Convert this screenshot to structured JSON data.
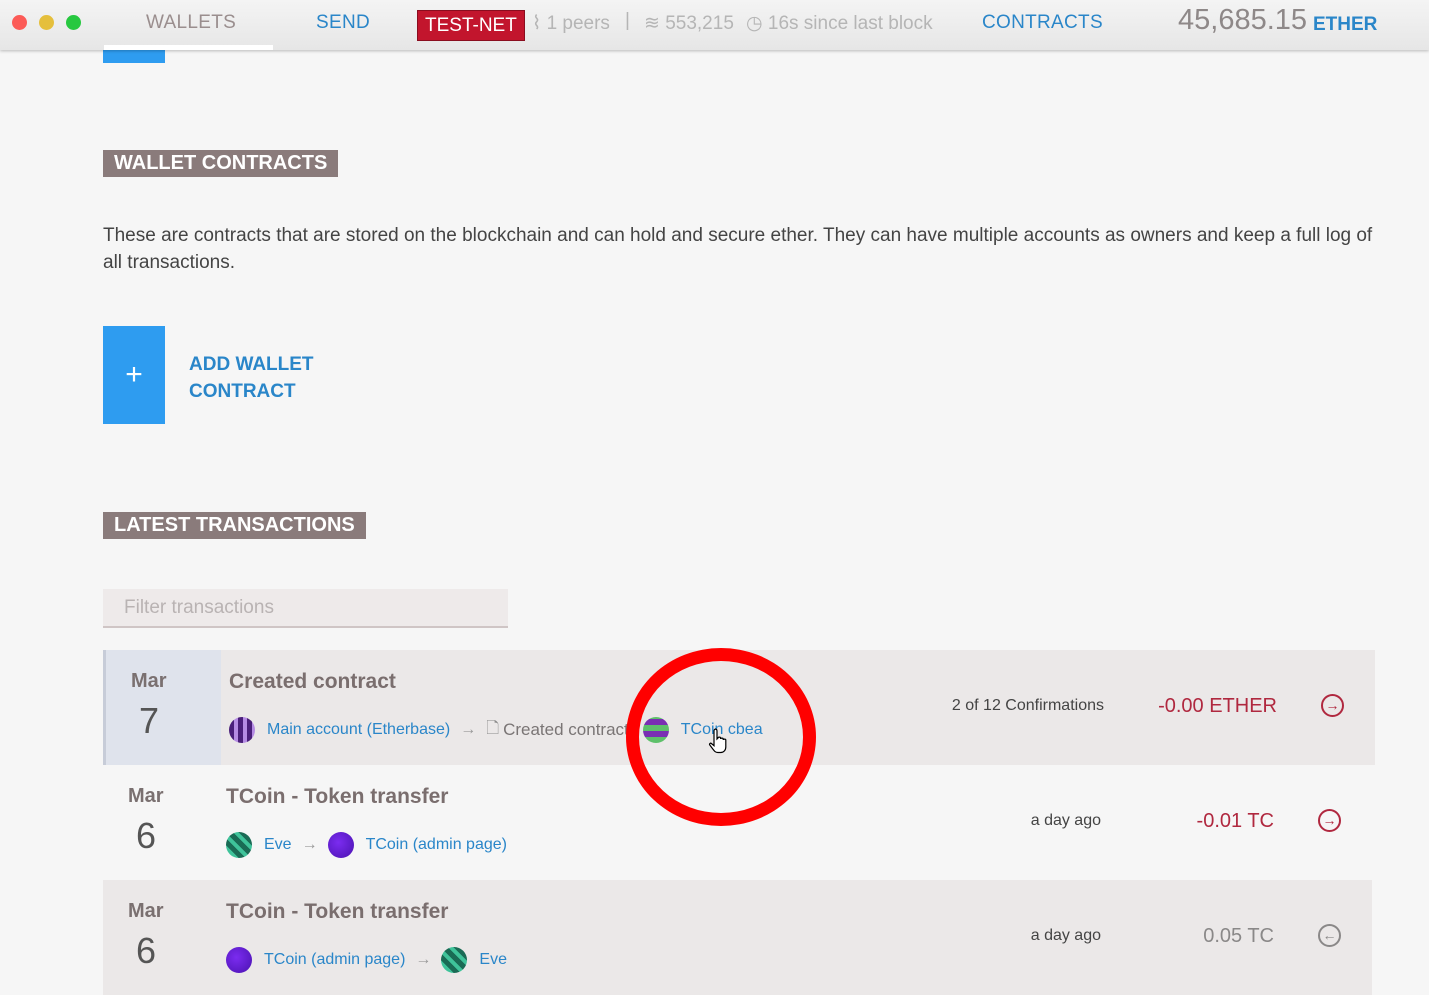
{
  "window": {
    "traffic_lights": [
      "#fc5b57",
      "#e5bf3c",
      "#27c840"
    ]
  },
  "nav": {
    "wallets": "WALLETS",
    "send": "SEND",
    "network_badge": "TEST-NET",
    "peers": "1 peers",
    "separator": "|",
    "block_number": "553,215",
    "since_last_block": "16s since last block",
    "contracts": "CONTRACTS",
    "balance": "45,685.15",
    "balance_unit": "ETHER"
  },
  "wallet_contracts": {
    "heading": "WALLET CONTRACTS",
    "description": "These are contracts that are stored on the blockchain and can hold and secure ether. They can have multiple accounts as owners and keep a full log of all transactions.",
    "add_button_icon": "+",
    "add_label": "ADD WALLET CONTRACT"
  },
  "latest_transactions": {
    "heading": "LATEST TRANSACTIONS",
    "filter_placeholder": "Filter transactions",
    "rows": [
      {
        "month": "Mar",
        "day": "7",
        "title": "Created contract",
        "from": "Main account (Etherbase)",
        "arrow": "→",
        "created_label": "Created contract",
        "to": "TCoin cbea",
        "status": "2 of 12 Confirmations",
        "amount": "-0.00 ETHER",
        "direction_icon": "arrow-right-circle-icon"
      },
      {
        "month": "Mar",
        "day": "6",
        "title": "TCoin - Token transfer",
        "from": "Eve",
        "arrow": "→",
        "to": "TCoin (admin page)",
        "status": "a day ago",
        "amount": "-0.01 TC",
        "direction_icon": "arrow-right-circle-icon"
      },
      {
        "month": "Mar",
        "day": "6",
        "title": "TCoin - Token transfer",
        "from": "TCoin (admin page)",
        "arrow": "→",
        "to": "Eve",
        "status": "a day ago",
        "amount": "0.05 TC",
        "direction_icon": "arrow-left-circle-icon"
      }
    ]
  },
  "colors": {
    "accent_blue": "#2a86c9",
    "testnet_red": "#c2152d",
    "negative_amount": "#b0283f",
    "annotation_circle": "#ff0000"
  }
}
